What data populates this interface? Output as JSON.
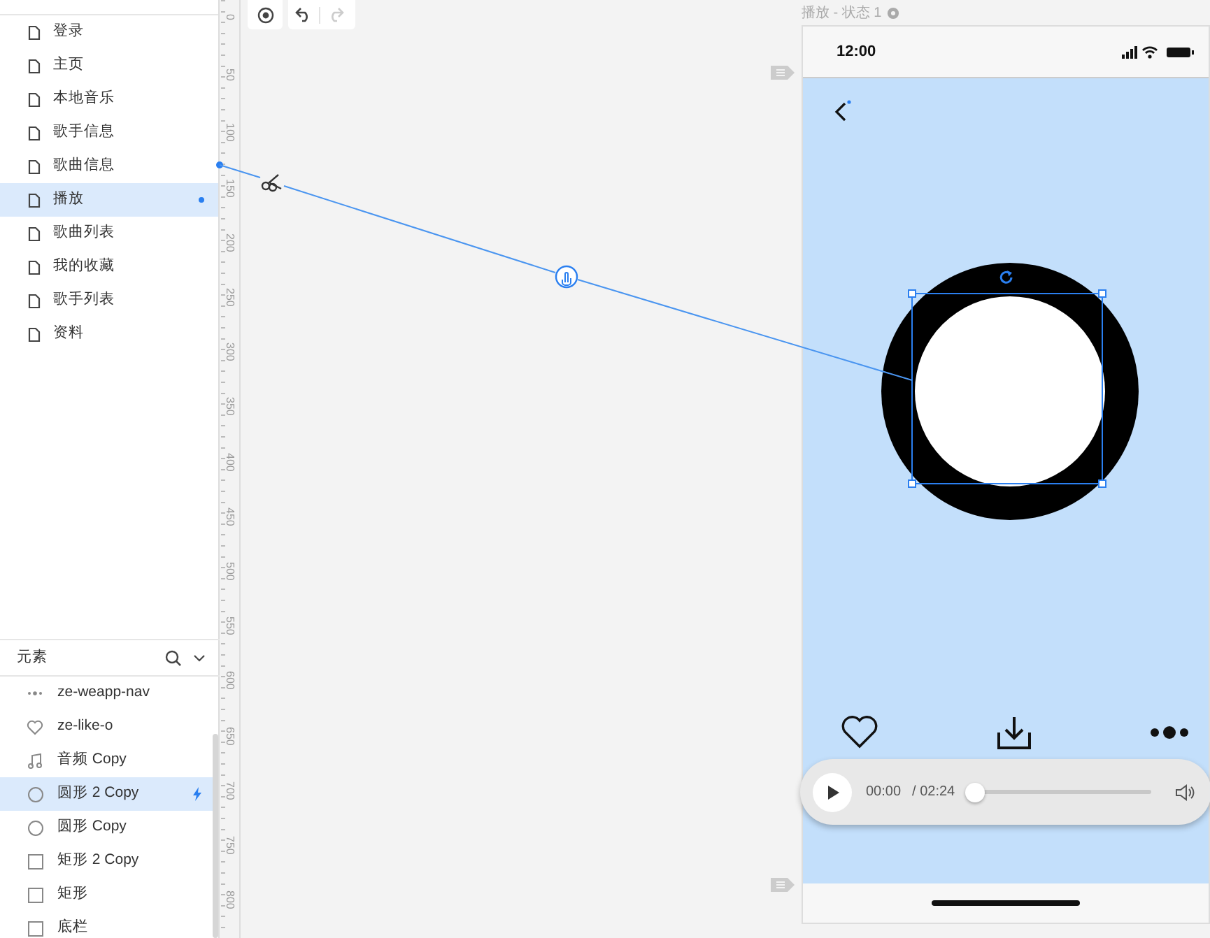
{
  "pages": [
    {
      "label": "登录",
      "selected": false
    },
    {
      "label": "主页",
      "selected": false
    },
    {
      "label": "本地音乐",
      "selected": false
    },
    {
      "label": "歌手信息",
      "selected": false
    },
    {
      "label": "歌曲信息",
      "selected": false
    },
    {
      "label": "播放",
      "selected": true
    },
    {
      "label": "歌曲列表",
      "selected": false
    },
    {
      "label": "我的收藏",
      "selected": false
    },
    {
      "label": "歌手列表",
      "selected": false
    },
    {
      "label": "资料",
      "selected": false
    }
  ],
  "elements_panel": {
    "title": "元素",
    "items": [
      {
        "label": "ze-weapp-nav",
        "kind": "dots",
        "selected": false,
        "has_interaction": false
      },
      {
        "label": "ze-like-o",
        "kind": "heart",
        "selected": false,
        "has_interaction": false
      },
      {
        "label": "音频 Copy",
        "kind": "audio",
        "selected": false,
        "has_interaction": false
      },
      {
        "label": "圆形 2 Copy",
        "kind": "circle",
        "selected": true,
        "has_interaction": true
      },
      {
        "label": "圆形 Copy",
        "kind": "circle",
        "selected": false,
        "has_interaction": false
      },
      {
        "label": "矩形 2 Copy",
        "kind": "rect",
        "selected": false,
        "has_interaction": false
      },
      {
        "label": "矩形",
        "kind": "rect",
        "selected": false,
        "has_interaction": false
      },
      {
        "label": "底栏",
        "kind": "rect",
        "selected": false,
        "has_interaction": false
      }
    ]
  },
  "toolbar": {
    "redo_disabled": true
  },
  "ruler": {
    "labels": [
      "0",
      "50",
      "100",
      "150",
      "200",
      "250",
      "300",
      "350",
      "400",
      "450",
      "500",
      "550",
      "600",
      "650",
      "700",
      "750",
      "800"
    ]
  },
  "frame": {
    "title": "播放 - 状态 1",
    "status_time": "12:00",
    "player": {
      "current": "00:00",
      "duration": "/ 02:24",
      "level": 0
    }
  }
}
